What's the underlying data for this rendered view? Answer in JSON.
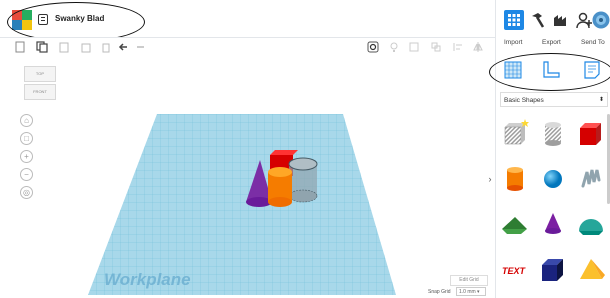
{
  "header": {
    "logo_letters": [
      "TIN",
      "KER",
      "CAD"
    ],
    "logo_colors": [
      "#e74c3c",
      "#27ae60",
      "#2980b9",
      "#f1c40f"
    ],
    "doc_icon": "document-icon",
    "title": "Swanky Blad"
  },
  "toolbar": {
    "left_icons": [
      "new-shape-icon",
      "copy-icon",
      "paste-icon",
      "duplicate-icon",
      "delete-icon",
      "undo-icon",
      "redo-icon"
    ],
    "right_icons": [
      "visibility-icon",
      "light-bulb-icon",
      "group-icon",
      "ungroup-icon",
      "align-icon",
      "mirror-icon"
    ]
  },
  "viewcube": {
    "top": "TOP",
    "front": "FRONT"
  },
  "nav": [
    "home-icon",
    "fit-icon",
    "zoom-in-icon",
    "zoom-out-icon",
    "ortho-icon"
  ],
  "workplane": {
    "label": "Workplane",
    "edit_grid": "Edit Grid",
    "snap_label": "Snap Grid",
    "snap_value": "1.0 mm ▾"
  },
  "right": {
    "top_icons": [
      "grid-view-icon",
      "hammer-icon",
      "blocks-icon",
      "profile-icon",
      "avatar-icon"
    ],
    "actions": [
      "Import",
      "Export",
      "Send To"
    ],
    "panel_icons": [
      "workplane-icon",
      "ruler-icon",
      "notes-icon"
    ],
    "dropdown": "Basic Shapes",
    "shapes": [
      "box-striped",
      "cylinder-striped",
      "box",
      "cylinder",
      "sphere",
      "scribble",
      "roof",
      "cone",
      "round-roof",
      "text",
      "polygon-box",
      "pyramid"
    ],
    "text_shape_label": "TEXT"
  },
  "colors": {
    "accent": "#1e88e5",
    "grid": "#a8d8ea",
    "gridline": "#6cbcd8"
  }
}
